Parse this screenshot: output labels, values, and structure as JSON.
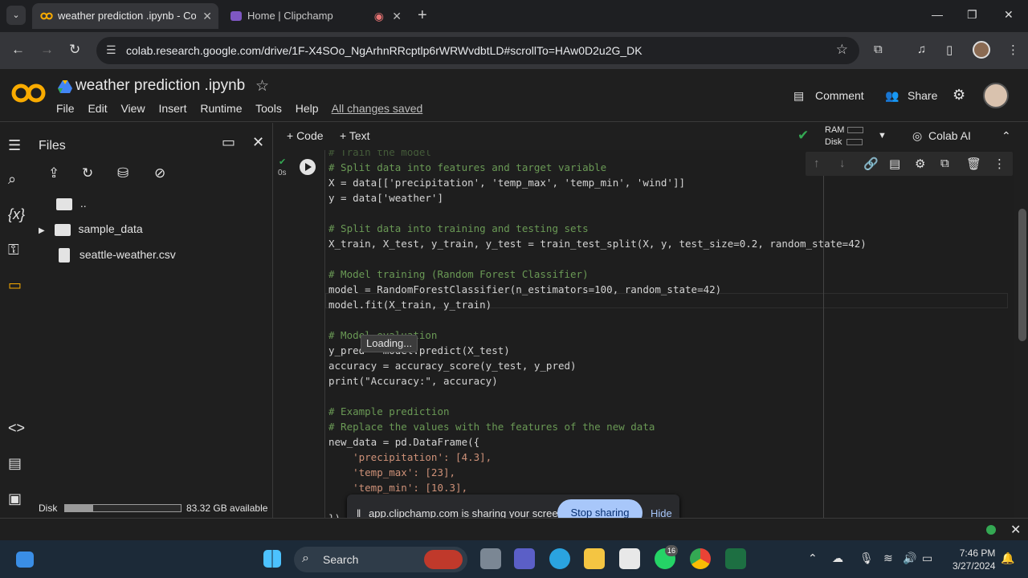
{
  "browser": {
    "tabs": [
      {
        "title": "weather prediction .ipynb - Cola",
        "favicon": "colab-logo-icon"
      },
      {
        "title": "Home | Clipchamp",
        "favicon": "clipchamp-icon"
      }
    ],
    "url": "colab.research.google.com/drive/1F-X4SOo_NgArhnRRcptlp6rWRWvdbtLD#scrollTo=HAw0D2u2G_DK"
  },
  "colab": {
    "logo_text": "CO",
    "notebook_title": "weather prediction .ipynb",
    "menu": [
      "File",
      "Edit",
      "View",
      "Insert",
      "Runtime",
      "Tools",
      "Help"
    ],
    "saved_status": "All changes saved",
    "comment_label": "Comment",
    "share_label": "Share",
    "add_code_label": "+ Code",
    "add_text_label": "+ Text",
    "ram_label": "RAM",
    "disk_label": "Disk",
    "colab_ai_label": "Colab AI"
  },
  "files_panel": {
    "title": "Files",
    "items": [
      {
        "name": "..",
        "type": "folder-up"
      },
      {
        "name": "sample_data",
        "type": "folder"
      },
      {
        "name": "seattle-weather.csv",
        "type": "file"
      }
    ],
    "disk_label": "Disk",
    "disk_available": "83.32 GB available",
    "disk_used_fraction": 0.24
  },
  "cell": {
    "exec_time": "0s",
    "loading_tooltip": "Loading...",
    "lines": [
      "# Train the model",
      "# Split data into features and target variable",
      "X = data[['precipitation', 'temp_max', 'temp_min', 'wind']]",
      "y = data['weather']",
      "",
      "# Split data into training and testing sets",
      "X_train, X_test, y_train, y_test = train_test_split(X, y, test_size=0.2, random_state=42)",
      "",
      "# Model training (Random Forest Classifier)",
      "model = RandomForestClassifier(n_estimators=100, random_state=42)",
      "model.fit(X_train, y_train)",
      "",
      "# Model evaluation",
      "y_pred = model.predict(X_test)",
      "accuracy = accuracy_score(y_test, y_pred)",
      "print(\"Accuracy:\", accuracy)",
      "",
      "# Example prediction",
      "# Replace the values with the features of the new data",
      "new_data = pd.DataFrame({",
      "    'precipitation': [4.3],",
      "    'temp_max': [23],",
      "    'temp_min': [10.3],",
      "",
      "})"
    ]
  },
  "sharing_bar": {
    "text": "app.clipchamp.com is sharing your screen.",
    "stop_label": "Stop sharing",
    "hide_label": "Hide"
  },
  "taskbar": {
    "search_label": "Search",
    "whatsapp_badge": "16",
    "time": "7:46 PM",
    "date": "3/27/2024"
  },
  "colors": {
    "accent_orange": "#f9ab00",
    "run_green": "#34a853",
    "stop_button": "#a8c7fa",
    "comment_green": "#6a9955",
    "string_orange": "#ce9178"
  }
}
